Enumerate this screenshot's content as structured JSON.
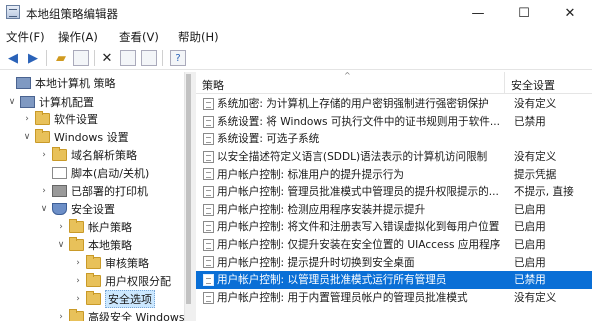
{
  "window": {
    "title": "本地组策略编辑器",
    "controls": [
      "—",
      "☐",
      "✕"
    ]
  },
  "menu": [
    "文件(F)",
    "操作(A)",
    "查看(V)",
    "帮助(H)"
  ],
  "tree": [
    {
      "label": "本地计算机 策略",
      "icon": "computer-icon"
    },
    {
      "label": "计算机配置",
      "icon": "computer-icon"
    },
    {
      "label": "软件设置",
      "icon": "folder-icon"
    },
    {
      "label": "Windows 设置",
      "icon": "folder-icon"
    },
    {
      "label": "域名解析策略",
      "icon": "folder-icon"
    },
    {
      "label": "脚本(启动/关机)",
      "icon": "script-icon"
    },
    {
      "label": "已部署的打印机",
      "icon": "printer-icon"
    },
    {
      "label": "安全设置",
      "icon": "shield-icon"
    },
    {
      "label": "帐户策略",
      "icon": "folder-icon"
    },
    {
      "label": "本地策略",
      "icon": "folder-icon"
    },
    {
      "label": "审核策略",
      "icon": "folder-icon"
    },
    {
      "label": "用户权限分配",
      "icon": "folder-icon"
    },
    {
      "label": "安全选项",
      "icon": "folder-icon"
    },
    {
      "label": "高级安全 Windows",
      "icon": "folder-icon"
    }
  ],
  "list": {
    "columns": [
      "策略",
      "安全设置"
    ],
    "rows": [
      {
        "name": "系统加密: 为计算机上存储的用户密钥强制进行强密钥保护",
        "value": "没有定义"
      },
      {
        "name": "系统设置: 将 Windows 可执行文件中的证书规则用于软件...",
        "value": "已禁用"
      },
      {
        "name": "系统设置: 可选子系统",
        "value": ""
      },
      {
        "name": "以安全描述符定义语言(SDDL)语法表示的计算机访问限制",
        "value": "没有定义"
      },
      {
        "name": "用户帐户控制: 标准用户的提升提示行为",
        "value": "提示凭据"
      },
      {
        "name": "用户帐户控制: 管理员批准模式中管理员的提升权限提示的...",
        "value": "不提示, 直接"
      },
      {
        "name": "用户帐户控制: 检测应用程序安装并提示提升",
        "value": "已启用"
      },
      {
        "name": "用户帐户控制: 将文件和注册表写入错误虚拟化到每用户位置",
        "value": "已启用"
      },
      {
        "name": "用户帐户控制: 仅提升安装在安全位置的 UIAccess 应用程序",
        "value": "已启用"
      },
      {
        "name": "用户帐户控制: 提示提升时切换到安全桌面",
        "value": "已启用"
      },
      {
        "name": "用户帐户控制: 以管理员批准模式运行所有管理员",
        "value": "已禁用"
      },
      {
        "name": "用户帐户控制: 用于内置管理员帐户的管理员批准模式",
        "value": "没有定义"
      }
    ]
  }
}
